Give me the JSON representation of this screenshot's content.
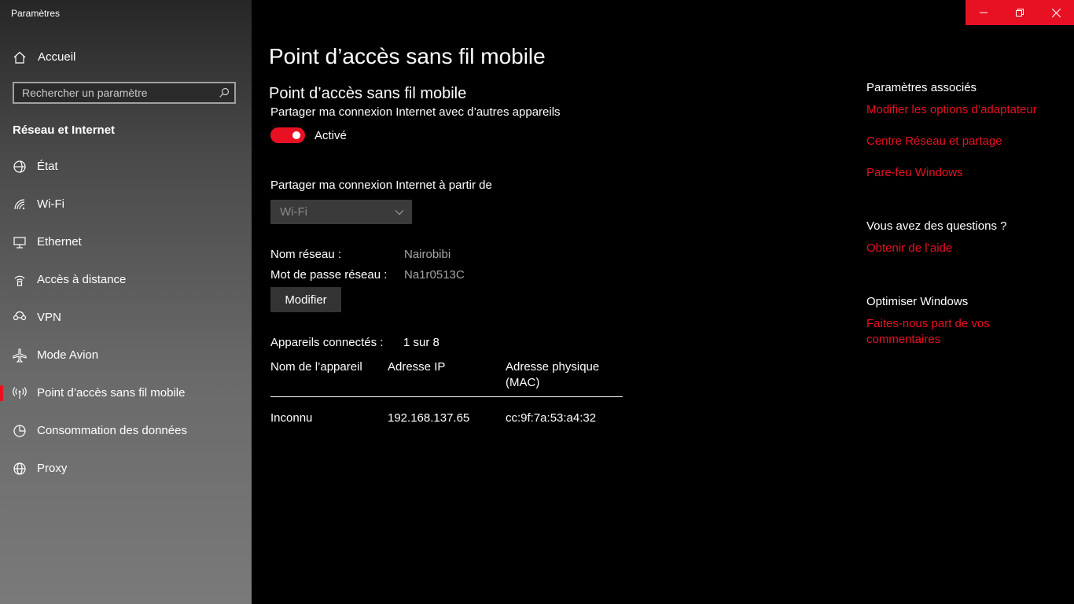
{
  "window": {
    "title": "Paramètres"
  },
  "sidebar": {
    "home_label": "Accueil",
    "search_placeholder": "Rechercher un paramètre",
    "section_title": "Réseau et Internet",
    "items": [
      {
        "label": "État",
        "icon": "home-status-icon"
      },
      {
        "label": "Wi-Fi",
        "icon": "wifi-icon"
      },
      {
        "label": "Ethernet",
        "icon": "ethernet-icon"
      },
      {
        "label": "Accès à distance",
        "icon": "dialup-icon"
      },
      {
        "label": "VPN",
        "icon": "vpn-icon"
      },
      {
        "label": "Mode Avion",
        "icon": "airplane-icon"
      },
      {
        "label": "Point d’accès sans fil mobile",
        "icon": "hotspot-icon",
        "selected": true
      },
      {
        "label": "Consommation des données",
        "icon": "data-usage-icon"
      },
      {
        "label": "Proxy",
        "icon": "globe-icon"
      }
    ]
  },
  "main": {
    "page_title": "Point d’accès sans fil mobile",
    "section_title": "Point d’accès sans fil mobile",
    "share_desc": "Partager ma connexion Internet avec d’autres appareils",
    "toggle_state": "Activé",
    "share_from_label": "Partager ma connexion Internet à partir de",
    "share_from_value": "Wi-Fi",
    "network_name_label": "Nom réseau :",
    "network_name_value": "Nairobibi",
    "password_label": "Mot de passe réseau :",
    "password_value": "Na1r0513C",
    "modify_button": "Modifier",
    "connected_label": "Appareils connectés :",
    "connected_value": "1 sur 8",
    "table": {
      "headers": [
        "Nom de l’appareil",
        "Adresse IP",
        "Adresse physique (MAC)"
      ],
      "rows": [
        [
          "Inconnu",
          "192.168.137.65",
          "cc:9f:7a:53:a4:32"
        ]
      ]
    }
  },
  "related": {
    "title": "Paramètres associés",
    "links": [
      "Modifier les options d’adaptateur",
      "Centre Réseau et partage",
      "Pare-feu Windows"
    ],
    "questions_title": "Vous avez des questions ?",
    "help_link": "Obtenir de l’aide",
    "optimize_title": "Optimiser Windows",
    "feedback_link": "Faites-nous part de vos commentaires"
  },
  "colors": {
    "accent": "#e81123",
    "background": "#000000"
  }
}
